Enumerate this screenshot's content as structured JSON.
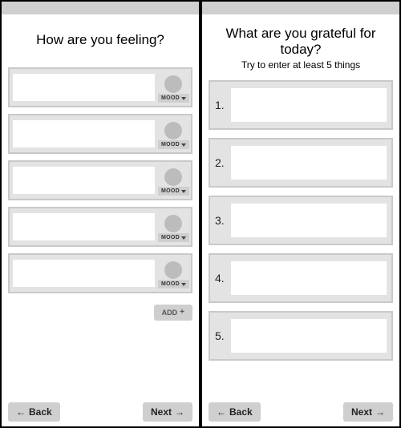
{
  "screens": {
    "mood": {
      "title": "How are you feeling?",
      "mood_chip_label": "MOOD",
      "rows": [
        {
          "value": ""
        },
        {
          "value": ""
        },
        {
          "value": ""
        },
        {
          "value": ""
        },
        {
          "value": ""
        }
      ],
      "add_label": "ADD"
    },
    "gratitude": {
      "title": "What are you grateful for today?",
      "subtitle": "Try to enter at least 5 things",
      "rows": [
        {
          "num": "1.",
          "value": ""
        },
        {
          "num": "2.",
          "value": ""
        },
        {
          "num": "3.",
          "value": ""
        },
        {
          "num": "4.",
          "value": ""
        },
        {
          "num": "5.",
          "value": ""
        }
      ]
    }
  },
  "nav": {
    "back_label": "Back",
    "next_label": "Next"
  }
}
